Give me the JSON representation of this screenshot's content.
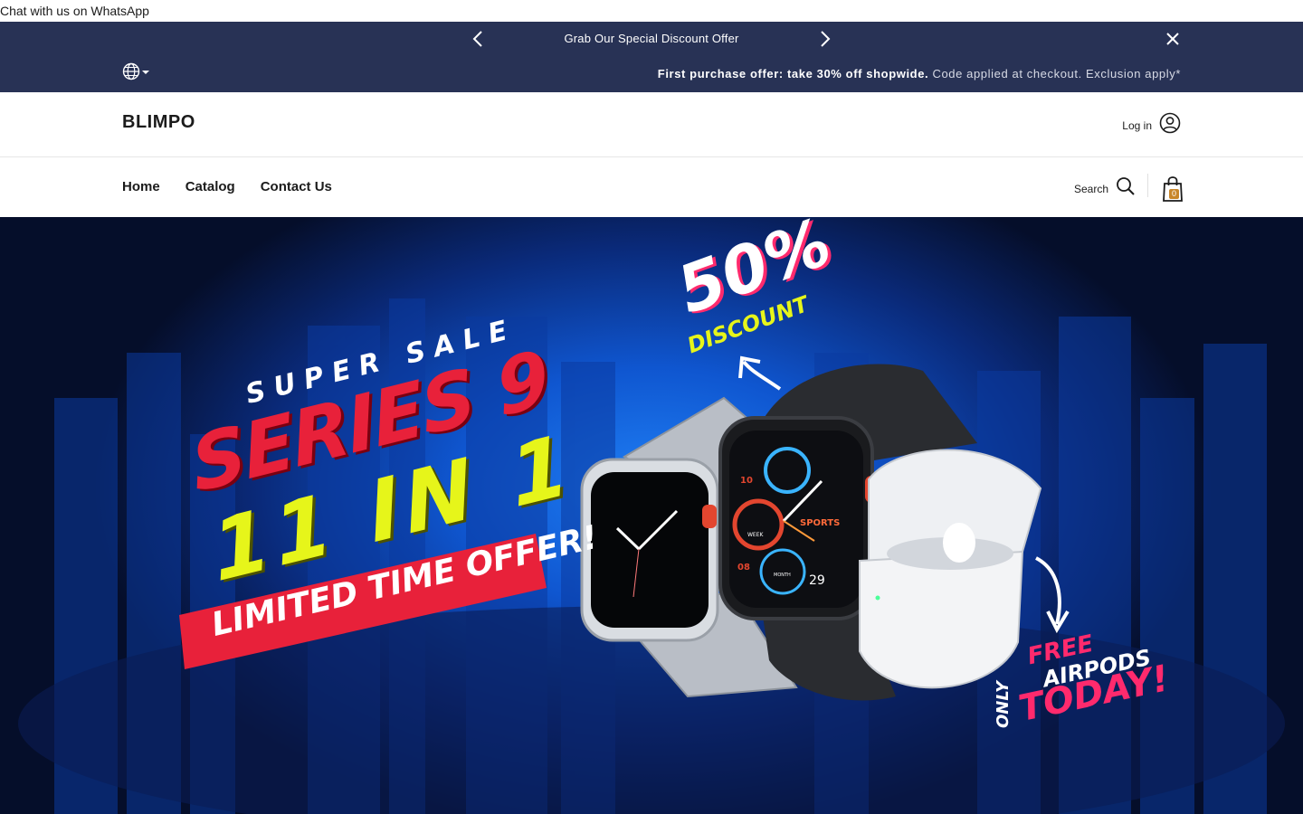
{
  "whatsapp": {
    "label": "Chat with us on WhatsApp"
  },
  "announcement": {
    "text": "Grab Our Special Discount Offer",
    "prev_icon": "chevron-left-icon",
    "next_icon": "chevron-right-icon",
    "close_icon": "close-icon",
    "language_icon": "globe-icon",
    "promo_strong": "First purchase offer: take 30% off shopwide.",
    "promo_rest": " Code applied at checkout. Exclusion apply*"
  },
  "header": {
    "logo": "BLIMPO",
    "login_label": "Log in",
    "login_icon": "user-circle-icon"
  },
  "nav": {
    "links": [
      "Home",
      "Catalog",
      "Contact Us"
    ],
    "search_label": "Search",
    "search_icon": "search-icon",
    "cart_icon": "shopping-bag-icon",
    "cart_count": "0"
  },
  "hero": {
    "super_sale": "SUPER SALE",
    "series": "SERIES 9",
    "eleven_in_one": "11 IN 1",
    "limited": "LIMITED TIME OFFER!",
    "discount_pct": "50%",
    "discount_word": "DISCOUNT",
    "free": "FREE",
    "airpods": "AIRPODS",
    "only": "ONLY",
    "today": "TODAY!",
    "watch_sports": "SPORTS",
    "watch_date": "29",
    "watch_10": "10",
    "watch_08": "08",
    "watch_week": "WEEK",
    "watch_month": "MONTH",
    "colors": {
      "red": "#e8213a",
      "yellow": "#e6f51a",
      "white": "#ffffff",
      "pink": "#ff2a6d"
    }
  }
}
